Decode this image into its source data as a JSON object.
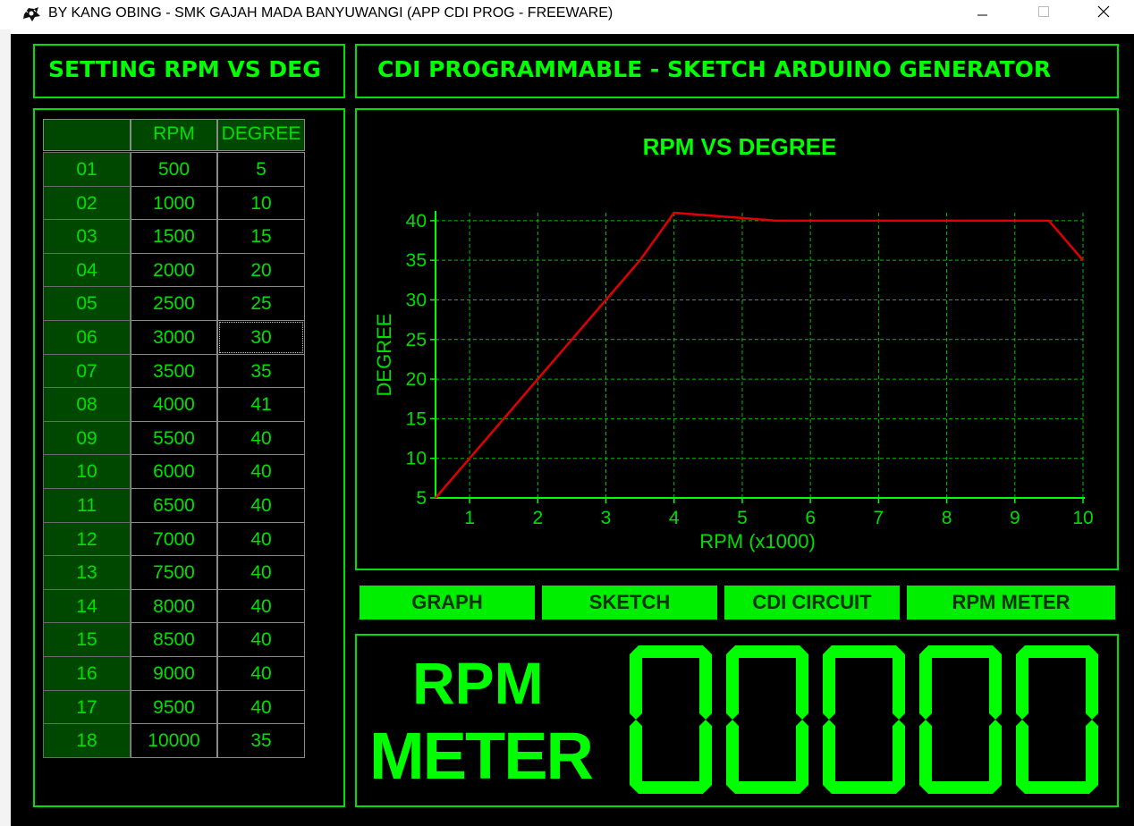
{
  "window": {
    "title": "BY KANG OBING - SMK GAJAH MADA BANYUWANGI (APP CDI PROG - FREEWARE)"
  },
  "headers": {
    "left": "SETTING RPM VS DEG",
    "right": "CDI PROGRAMMABLE - SKETCH ARDUINO GENERATOR"
  },
  "table": {
    "columns": [
      "",
      "RPM",
      "DEGREE"
    ],
    "rows": [
      {
        "no": "01",
        "rpm": "500",
        "deg": "5"
      },
      {
        "no": "02",
        "rpm": "1000",
        "deg": "10"
      },
      {
        "no": "03",
        "rpm": "1500",
        "deg": "15"
      },
      {
        "no": "04",
        "rpm": "2000",
        "deg": "20"
      },
      {
        "no": "05",
        "rpm": "2500",
        "deg": "25"
      },
      {
        "no": "06",
        "rpm": "3000",
        "deg": "30"
      },
      {
        "no": "07",
        "rpm": "3500",
        "deg": "35"
      },
      {
        "no": "08",
        "rpm": "4000",
        "deg": "41"
      },
      {
        "no": "09",
        "rpm": "5500",
        "deg": "40"
      },
      {
        "no": "10",
        "rpm": "6000",
        "deg": "40"
      },
      {
        "no": "11",
        "rpm": "6500",
        "deg": "40"
      },
      {
        "no": "12",
        "rpm": "7000",
        "deg": "40"
      },
      {
        "no": "13",
        "rpm": "7500",
        "deg": "40"
      },
      {
        "no": "14",
        "rpm": "8000",
        "deg": "40"
      },
      {
        "no": "15",
        "rpm": "8500",
        "deg": "40"
      },
      {
        "no": "16",
        "rpm": "9000",
        "deg": "40"
      },
      {
        "no": "17",
        "rpm": "9500",
        "deg": "40"
      },
      {
        "no": "18",
        "rpm": "10000",
        "deg": "35"
      }
    ],
    "selected_row": 5
  },
  "chart_data": {
    "type": "line",
    "title": "RPM VS DEGREE",
    "xlabel": "RPM (x1000)",
    "ylabel": "DEGREE",
    "xlim": [
      0.5,
      10
    ],
    "ylim": [
      5,
      41
    ],
    "xticks": [
      1,
      2,
      3,
      4,
      5,
      6,
      7,
      8,
      9,
      10
    ],
    "yticks": [
      5,
      10,
      15,
      20,
      25,
      30,
      35,
      40
    ],
    "grid": true,
    "series": [
      {
        "color": "#e00000",
        "x": [
          0.5,
          1,
          1.5,
          2,
          2.5,
          3,
          3.5,
          4,
          5.5,
          6,
          6.5,
          7,
          7.5,
          8,
          8.5,
          9,
          9.5,
          10
        ],
        "y": [
          5,
          10,
          15,
          20,
          25,
          30,
          35,
          41,
          40,
          40,
          40,
          40,
          40,
          40,
          40,
          40,
          40,
          35
        ]
      }
    ]
  },
  "tabs": [
    "GRAPH",
    "SKETCH",
    "CDI CIRCUIT",
    "RPM METER"
  ],
  "rpm_meter": {
    "label_line1": "RPM",
    "label_line2": "METER",
    "digits": [
      "0",
      "0",
      "0",
      "0",
      "0"
    ]
  },
  "colors": {
    "accent": "#00ff00",
    "cell_bg": "#004800",
    "line": "#e00000",
    "background": "#000000"
  }
}
